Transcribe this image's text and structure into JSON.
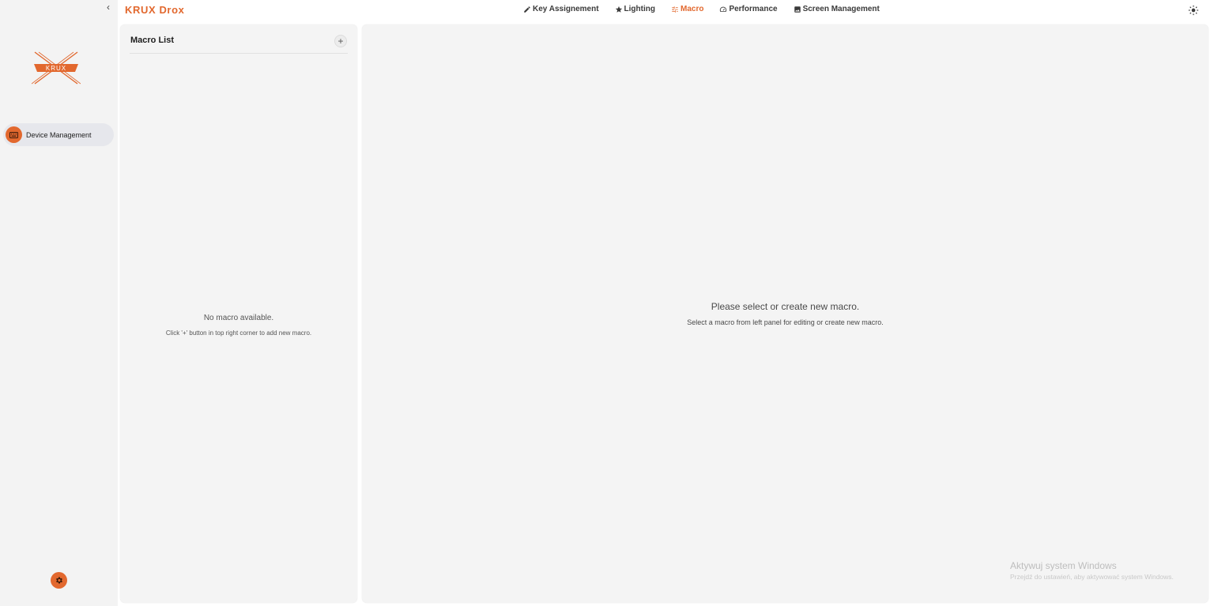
{
  "app": {
    "title": "KRUX Drox"
  },
  "sidebar": {
    "collapse_glyph": "‹",
    "logo_text": "KRUX",
    "items": [
      {
        "label": "Device Management",
        "icon": "keyboard-icon",
        "active": true
      }
    ],
    "settings_icon": "gear-icon"
  },
  "tabs": [
    {
      "label": "Key Assignement",
      "icon": "pencil-icon",
      "active": false
    },
    {
      "label": "Lighting",
      "icon": "star-icon",
      "active": false
    },
    {
      "label": "Macro",
      "icon": "macro-icon",
      "active": true
    },
    {
      "label": "Performance",
      "icon": "gauge-icon",
      "active": false
    },
    {
      "label": "Screen Management",
      "icon": "image-icon",
      "active": false
    }
  ],
  "theme_toggle_icon": "sun-icon",
  "macro_list": {
    "title": "Macro List",
    "add_label": "+",
    "empty_title": "No macro available.",
    "empty_hint": "Click '+' button in top right corner to add new macro."
  },
  "editor": {
    "empty_title": "Please select or create new macro.",
    "empty_hint": "Select a macro from left panel for editing or create new macro."
  },
  "watermark": {
    "title": "Aktywuj system Windows",
    "subtitle": "Przejdź do ustawień, aby aktywować system Windows."
  },
  "colors": {
    "accent": "#e2682e",
    "sidebar_bg": "#f3f3f3",
    "panel_bg": "#f4f4f4",
    "nav_active_bg": "#e6e7ec"
  }
}
